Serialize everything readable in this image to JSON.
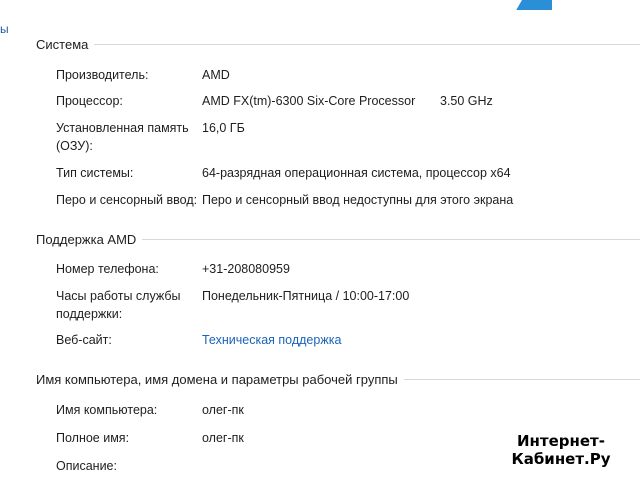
{
  "left_edge_text": "ы",
  "sections": {
    "system": {
      "title": "Система",
      "manufacturer_label": "Производитель:",
      "manufacturer_value": "AMD",
      "processor_label": "Процессор:",
      "processor_value": "AMD FX(tm)-6300 Six-Core Processor",
      "processor_speed": "3.50 GHz",
      "memory_label_line1": "Установленная память",
      "memory_label_line2": "(ОЗУ):",
      "memory_value": "16,0 ГБ",
      "system_type_label": "Тип системы:",
      "system_type_value": "64-разрядная операционная система, процессор x64",
      "pen_touch_label": "Перо и сенсорный ввод:",
      "pen_touch_value": "Перо и сенсорный ввод недоступны для этого экрана"
    },
    "support": {
      "title": "Поддержка AMD",
      "phone_label": "Номер телефона:",
      "phone_value": "+31-208080959",
      "hours_label_line1": "Часы работы службы",
      "hours_label_line2": "поддержки:",
      "hours_value": "Понедельник-Пятница / 10:00-17:00",
      "website_label": "Веб-сайт:",
      "website_link": "Техническая поддержка"
    },
    "computer": {
      "title": "Имя компьютера, имя домена и параметры рабочей группы",
      "computer_name_label": "Имя компьютера:",
      "computer_name_value": "олег-пк",
      "full_name_label": "Полное имя:",
      "full_name_value": "олег-пк",
      "description_label": "Описание:",
      "description_value": ""
    }
  },
  "watermark": {
    "line1": "Интернет-",
    "line2": "Кабинет.Ру"
  },
  "colors": {
    "link": "#1a63b8",
    "divider": "#d8d8d8",
    "text": "#1e1e1e",
    "windows_blue": "#2b8fd8"
  }
}
